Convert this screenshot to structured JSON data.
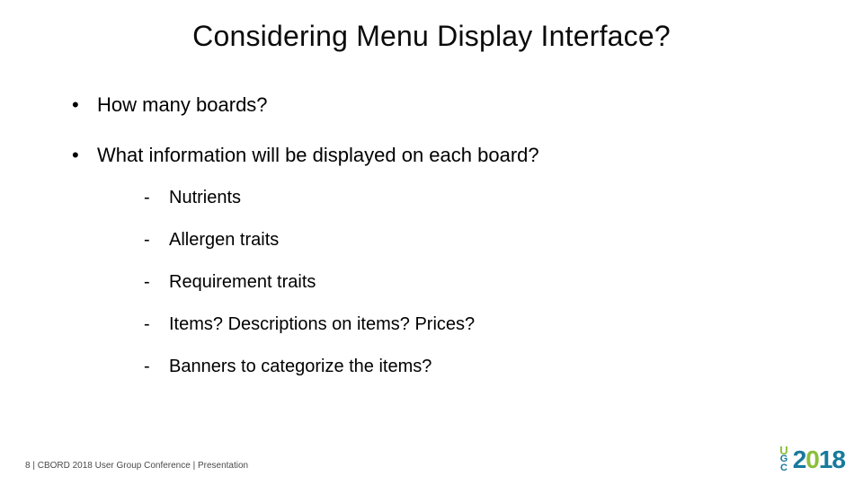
{
  "title": "Considering Menu Display Interface?",
  "bullets": {
    "a": "How many boards?",
    "b": "What information will be displayed on each board?",
    "b1": "Nutrients",
    "b2": "Allergen traits",
    "b3": "Requirement traits",
    "b4": "Items?  Descriptions on items?  Prices?",
    "b5": "Banners to categorize the items?"
  },
  "footer": {
    "page": "8",
    "sep": " |  ",
    "text": "CBORD 2018 User Group Conference | Presentation"
  },
  "logo": {
    "u": "U",
    "g": "G",
    "c": "C",
    "y1": "2",
    "y2": "0",
    "y3": "1",
    "y4": "8"
  }
}
